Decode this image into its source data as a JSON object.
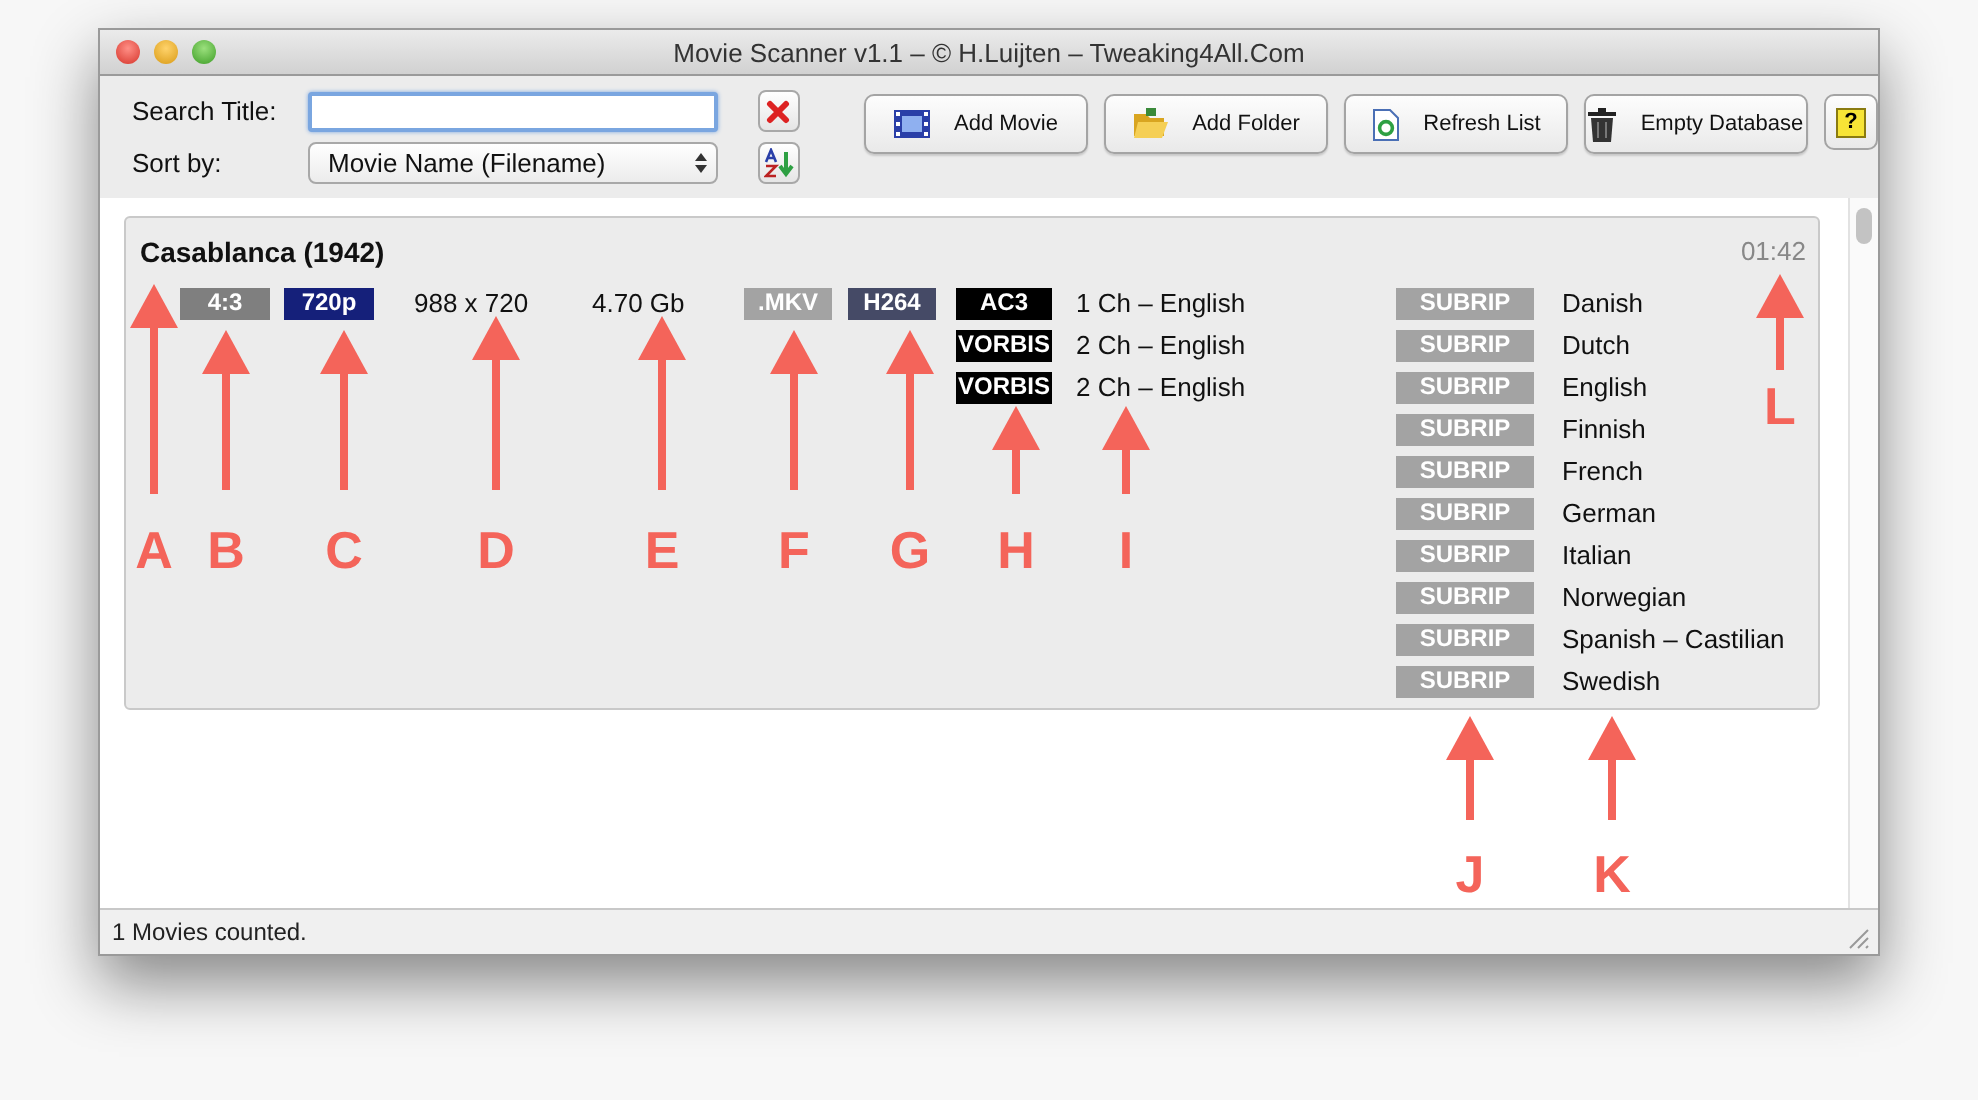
{
  "window": {
    "title": "Movie Scanner v1.1 – © H.Luijten – Tweaking4All.Com"
  },
  "search": {
    "label": "Search Title:"
  },
  "sort": {
    "label": "Sort by:",
    "value": "Movie Name (Filename)"
  },
  "buttons": [
    {
      "label": "Add Movie",
      "kind": "film"
    },
    {
      "label": "Add Folder",
      "kind": "folder"
    },
    {
      "label": "Refresh List",
      "kind": "refresh"
    },
    {
      "label": "Empty Database",
      "kind": "trash"
    }
  ],
  "help_button": {
    "label": "?"
  },
  "movie": {
    "title": "Casablanca (1942)",
    "duration": "01:42",
    "aspect": {
      "text": "4:3",
      "color": "#7f7f7f"
    },
    "resolution": {
      "text": "720p",
      "color": "#15207a"
    },
    "dimensions": "988 x 720",
    "size": "4.70 Gb",
    "container": {
      "text": ".MKV",
      "color": "#a3a3a3"
    },
    "video_codec": {
      "text": "H264",
      "color": "#454a66"
    },
    "audio_tracks": [
      {
        "codec": "AC3",
        "color": "#000000",
        "description": "1 Ch – English"
      },
      {
        "codec": "VORBIS",
        "color": "#000000",
        "description": "2 Ch – English"
      },
      {
        "codec": "VORBIS",
        "color": "#000000",
        "description": "2 Ch – English"
      }
    ],
    "subtitles": [
      {
        "codec": "SUBRIP",
        "color": "#a3a3a3",
        "language": "Danish"
      },
      {
        "codec": "SUBRIP",
        "color": "#a3a3a3",
        "language": "Dutch"
      },
      {
        "codec": "SUBRIP",
        "color": "#a3a3a3",
        "language": "English"
      },
      {
        "codec": "SUBRIP",
        "color": "#a3a3a3",
        "language": "Finnish"
      },
      {
        "codec": "SUBRIP",
        "color": "#a3a3a3",
        "language": "French"
      },
      {
        "codec": "SUBRIP",
        "color": "#a3a3a3",
        "language": "German"
      },
      {
        "codec": "SUBRIP",
        "color": "#a3a3a3",
        "language": "Italian"
      },
      {
        "codec": "SUBRIP",
        "color": "#a3a3a3",
        "language": "Norwegian"
      },
      {
        "codec": "SUBRIP",
        "color": "#a3a3a3",
        "language": "Spanish – Castilian"
      },
      {
        "codec": "SUBRIP",
        "color": "#a3a3a3",
        "language": "Swedish"
      }
    ]
  },
  "status_bar": "1 Movies counted.",
  "annotations": [
    {
      "letter": "A"
    },
    {
      "letter": "B"
    },
    {
      "letter": "C"
    },
    {
      "letter": "D"
    },
    {
      "letter": "E"
    },
    {
      "letter": "F"
    },
    {
      "letter": "G"
    },
    {
      "letter": "H"
    },
    {
      "letter": "I"
    },
    {
      "letter": "J"
    },
    {
      "letter": "K"
    },
    {
      "letter": "L"
    }
  ]
}
